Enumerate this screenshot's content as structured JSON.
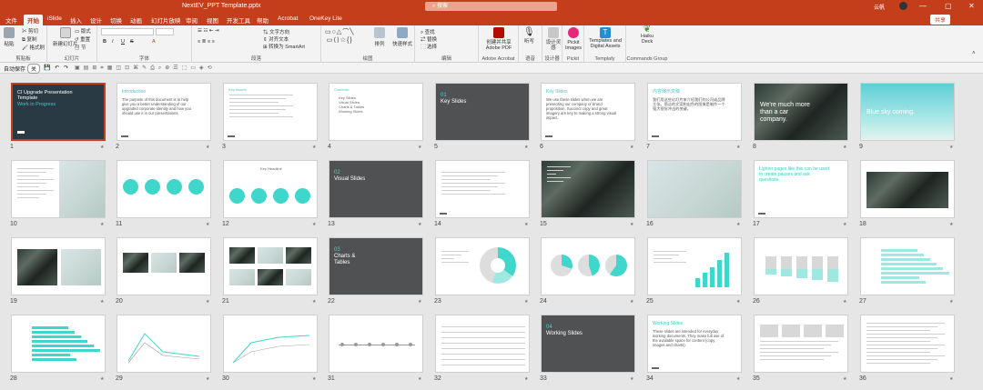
{
  "window": {
    "doc_title": "NextEV_PPT Template.pptx",
    "search_placeholder": "搜索",
    "user": "云帆",
    "controls": [
      "—",
      "▢",
      "✕"
    ]
  },
  "menu": {
    "tabs": [
      "文件",
      "开始",
      "iSlide",
      "插入",
      "设计",
      "切换",
      "动画",
      "幻灯片放映",
      "审阅",
      "视图",
      "开发工具",
      "帮助",
      "Acrobat",
      "OneKey Lite"
    ],
    "active": "开始",
    "share": "共享"
  },
  "ribbon": {
    "groups": [
      {
        "label": "剪贴板",
        "buttons": [
          "粘贴",
          "剪切",
          "复制",
          "格式刷"
        ]
      },
      {
        "label": "幻灯片",
        "buttons": [
          "新建幻灯片",
          "版式",
          "重置",
          "节"
        ]
      },
      {
        "label": "字体",
        "buttons": [
          "B",
          "I",
          "U",
          "S"
        ]
      },
      {
        "label": "段落",
        "buttons": [
          "文字方向",
          "对齐文本",
          "转换为 SmartArt"
        ]
      },
      {
        "label": "绘图",
        "buttons": [
          "排列",
          "快速样式"
        ]
      },
      {
        "label": "编辑",
        "buttons": [
          "查找",
          "替换",
          "选择"
        ]
      },
      {
        "label": "Adobe Acrobat",
        "buttons": [
          "创建并共享 Adobe PDF"
        ]
      },
      {
        "label": "语音",
        "buttons": [
          "听写"
        ]
      },
      {
        "label": "设计器",
        "buttons": [
          "设计灵感"
        ]
      },
      {
        "label": "Pickit",
        "buttons": [
          "Pickit Images"
        ]
      },
      {
        "label": "Templafy",
        "buttons": [
          "Templates and Digital Assets"
        ]
      },
      {
        "label": "Commands Group",
        "buttons": [
          "Haiku Deck"
        ]
      }
    ]
  },
  "qat": {
    "autosave": "自动保存",
    "toggle": "关"
  },
  "slides": [
    {
      "n": "1",
      "kind": "dark-title",
      "title": "CI Upgrade Presentation Template",
      "sub": "Work in Progress"
    },
    {
      "n": "2",
      "kind": "text",
      "title": "Introduction",
      "body": "The purpose of this document is to help give you a better understanding of our upgraded corporate identity and how you should use it in our presentations."
    },
    {
      "n": "3",
      "kind": "bullets",
      "title": "Key Issues"
    },
    {
      "n": "4",
      "kind": "list",
      "title": "Contents",
      "items": [
        "Key Slides",
        "Visual Slides",
        "Charts & Tables",
        "Working Slides"
      ]
    },
    {
      "n": "5",
      "kind": "section",
      "title": "01 Key Slides"
    },
    {
      "n": "6",
      "kind": "text",
      "title": "Key Slides",
      "body": "We use these slides when we are presenting our company or brand proposition. Succinct copy and great imagery are key to making a strong visual impact."
    },
    {
      "n": "7",
      "kind": "text",
      "title": "内容演示文稿",
      "body": "我们用这些幻灯片来介绍我们的公司或品牌主张。简洁的文案和出色的图像是制作一个强大视觉冲击的关键。"
    },
    {
      "n": "8",
      "kind": "photo-quote",
      "title": "We're much more than a car company."
    },
    {
      "n": "9",
      "kind": "sky",
      "title": "Blue sky coming."
    },
    {
      "n": "10",
      "kind": "photo-text"
    },
    {
      "n": "11",
      "kind": "circles"
    },
    {
      "n": "12",
      "kind": "circles-2",
      "title": "Key Headline"
    },
    {
      "n": "13",
      "kind": "section",
      "title": "02 Visual Slides"
    },
    {
      "n": "14",
      "kind": "bullets"
    },
    {
      "n": "15",
      "kind": "car-text"
    },
    {
      "n": "16",
      "kind": "photo-text2"
    },
    {
      "n": "17",
      "kind": "text",
      "title": "Lighter pages like this can be used to create pauses and ask questions."
    },
    {
      "n": "18",
      "kind": "car-img"
    },
    {
      "n": "19",
      "kind": "two-photo"
    },
    {
      "n": "20",
      "kind": "three-photo"
    },
    {
      "n": "21",
      "kind": "six-photo"
    },
    {
      "n": "22",
      "kind": "section",
      "title": "03 Charts & Tables"
    },
    {
      "n": "23",
      "kind": "donut"
    },
    {
      "n": "24",
      "kind": "pies"
    },
    {
      "n": "25",
      "kind": "bars"
    },
    {
      "n": "26",
      "kind": "stacked"
    },
    {
      "n": "27",
      "kind": "hbars"
    },
    {
      "n": "28",
      "kind": "hbars2"
    },
    {
      "n": "29",
      "kind": "line"
    },
    {
      "n": "30",
      "kind": "line2"
    },
    {
      "n": "31",
      "kind": "timeline"
    },
    {
      "n": "32",
      "kind": "table"
    },
    {
      "n": "33",
      "kind": "section",
      "title": "04 Working Slides"
    },
    {
      "n": "34",
      "kind": "text",
      "title": "Working Slides",
      "body": "These slides are intended for everyday working documents. They make full use of the available space for content (copy, images and charts)."
    },
    {
      "n": "35",
      "kind": "columns"
    },
    {
      "n": "36",
      "kind": "dense-text"
    }
  ]
}
